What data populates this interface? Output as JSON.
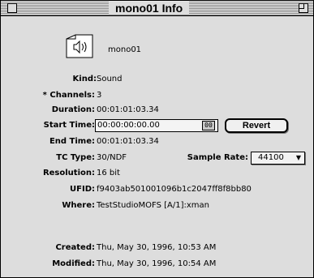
{
  "window": {
    "title": "mono01 Info"
  },
  "file": {
    "name": "mono01",
    "icon": "speaker-file-icon"
  },
  "fields": {
    "kind": {
      "label": "Kind:",
      "value": "Sound"
    },
    "channels": {
      "label": "* Channels:",
      "value": "3"
    },
    "duration": {
      "label": "Duration:",
      "value": "00:01:01:03.34"
    },
    "start_time": {
      "label": "Start Time:",
      "value": "00:00:00:00.00",
      "button_label": "00"
    },
    "revert_label": "Revert",
    "end_time": {
      "label": "End Time:",
      "value": "00:01:01:03.34"
    },
    "tc_type": {
      "label": "TC Type:",
      "value": "30/NDF"
    },
    "sample_rate": {
      "label": "Sample Rate:",
      "value": "44100",
      "arrow": "▼"
    },
    "resolution": {
      "label": "Resolution:",
      "value": "16 bit"
    },
    "ufid": {
      "label": "UFID:",
      "value": "f9403ab501001096b1c2047ff8f8bb80"
    },
    "where": {
      "label": "Where:",
      "value": "TestStudioMOFS [A/1]:xman"
    },
    "created": {
      "label": "Created:",
      "value": "Thu, May 30, 1996, 10:53 AM"
    },
    "modified": {
      "label": "Modified:",
      "value": "Thu, May 30, 1996, 10:54 AM"
    }
  }
}
